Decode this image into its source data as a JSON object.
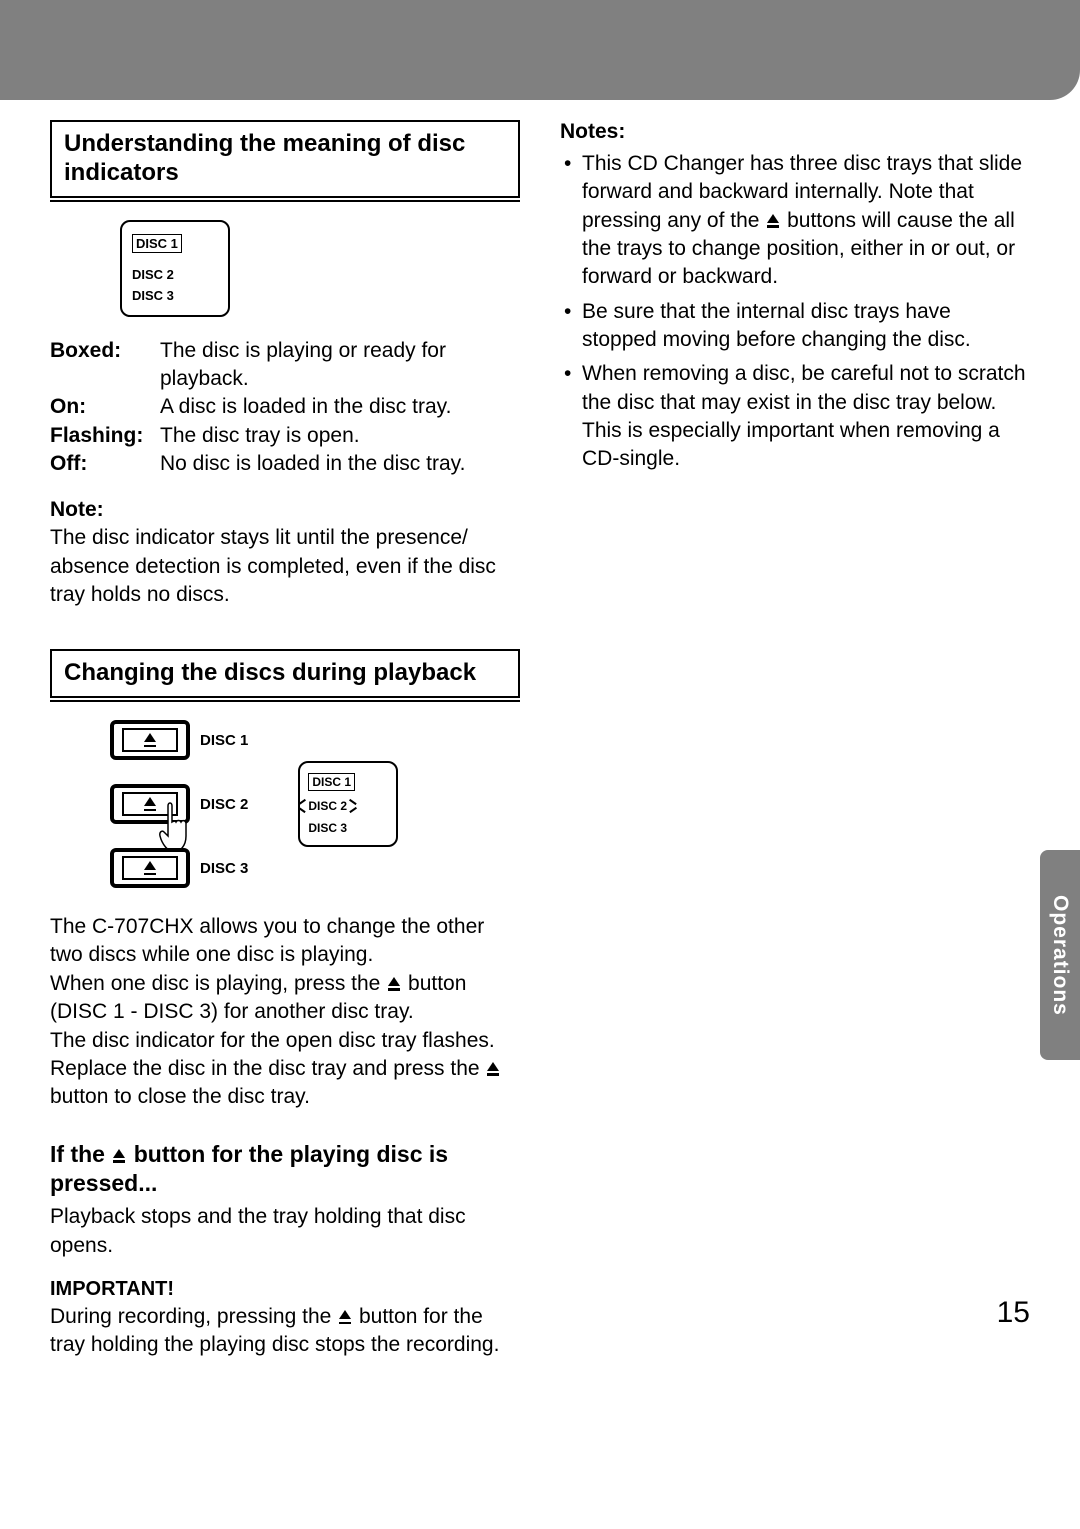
{
  "side_tab": "Operations",
  "page_number": "15",
  "left": {
    "section1_title": "Understanding the meaning of disc indicators",
    "display1": {
      "d1": "DISC 1",
      "d2": "DISC 2",
      "d3": "DISC 3"
    },
    "defs": {
      "boxed_k": "Boxed:",
      "boxed_v": "The disc is playing or ready for playback.",
      "on_k": "On:",
      "on_v": "A disc is loaded in the disc tray.",
      "flash_k": "Flashing:",
      "flash_v": "The disc tray is open.",
      "off_k": "Off:",
      "off_v": "No disc is loaded in the disc tray."
    },
    "note1_h": "Note:",
    "note1": "The disc indicator stays lit until the presence/ absence detection is completed, even if the disc tray holds no discs.",
    "section2_title": "Changing the discs during playback",
    "tray_labels": {
      "d1": "DISC 1",
      "d2": "DISC 2",
      "d3": "DISC 3"
    },
    "display2": {
      "d1": "DISC 1",
      "d2": "DISC 2",
      "d3": "DISC 3"
    },
    "para2a": "The C-707CHX allows you to change the other two discs while one disc is playing.",
    "para2b_pre": "When one disc is playing, press the ",
    "para2b_post": " button (DISC 1 - DISC 3) for another disc tray.",
    "para2c": "The disc indicator for the open disc tray flashes.",
    "para2d_pre": "Replace the disc in the disc tray and press the ",
    "para2d_post": " button to close the disc tray.",
    "sub_h_pre": "If the ",
    "sub_h_post": " button for the playing disc is pressed...",
    "sub_p": "Playback stops and the tray holding that disc opens.",
    "important_h": "IMPORTANT!",
    "important_p_pre": "During recording, pressing the ",
    "important_p_post": " button for the tray holding the playing disc stops the recording."
  },
  "right": {
    "notes_h": "Notes:",
    "n1_pre": "This CD Changer has three disc trays that slide forward and backward internally. Note that pressing any of the ",
    "n1_post": " buttons will cause the all the trays to change position, either in or out, or forward or backward.",
    "n2": "Be sure that the internal disc trays have stopped moving before changing the disc.",
    "n3": "When removing a disc, be careful not to scratch the disc that may exist in the disc tray below. This is especially important when removing a CD-single."
  }
}
